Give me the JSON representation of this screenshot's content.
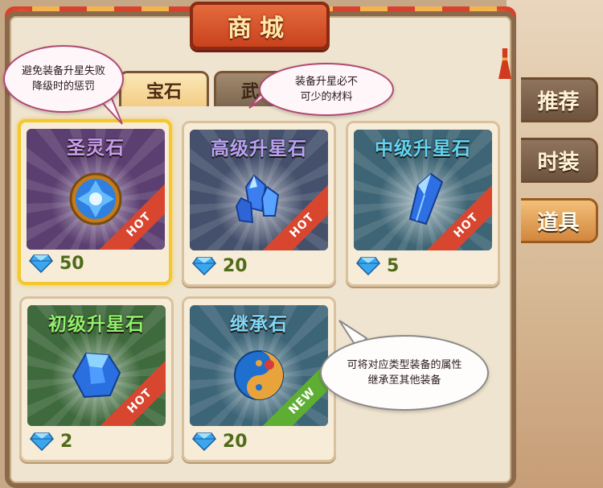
{
  "shop_title": "商城",
  "tabs": [
    {
      "label": "宝石",
      "active": true
    },
    {
      "label": "武器",
      "active": false
    }
  ],
  "side_tabs": [
    {
      "label": "推荐",
      "active": false
    },
    {
      "label": "时装",
      "active": false
    },
    {
      "label": "道具",
      "active": true
    }
  ],
  "items": [
    {
      "name": "圣灵石",
      "name_color": "#c99cf0",
      "price": "50",
      "tag": "HOT",
      "selected": true,
      "icon": "holy-spirit-stone-icon"
    },
    {
      "name": "高级升星石",
      "name_color": "#b7a3f5",
      "price": "20",
      "tag": "HOT",
      "selected": false,
      "icon": "blue-crystal-cluster-icon"
    },
    {
      "name": "中级升星石",
      "name_color": "#5fd6f4",
      "price": "5",
      "tag": "HOT",
      "selected": false,
      "icon": "blue-crystal-icon"
    },
    {
      "name": "初级升星石",
      "name_color": "#8ff06a",
      "price": "2",
      "tag": "HOT",
      "selected": false,
      "icon": "blue-ore-icon"
    },
    {
      "name": "继承石",
      "name_color": "#7fd8f7",
      "price": "20",
      "tag": "NEW",
      "selected": false,
      "icon": "taiji-orb-icon"
    }
  ],
  "currency_icon": "diamond-icon",
  "callouts": [
    {
      "text": "避免装备升星失败降级时的惩罚"
    },
    {
      "text": "装备升星必不可少的材料"
    },
    {
      "text": "可将对应类型装备的属性继承至其他装备"
    }
  ],
  "colors": {
    "hot": "#d9462f",
    "new": "#5fae34",
    "price": "#4f6b1a",
    "selected_border": "#f4c72c"
  }
}
